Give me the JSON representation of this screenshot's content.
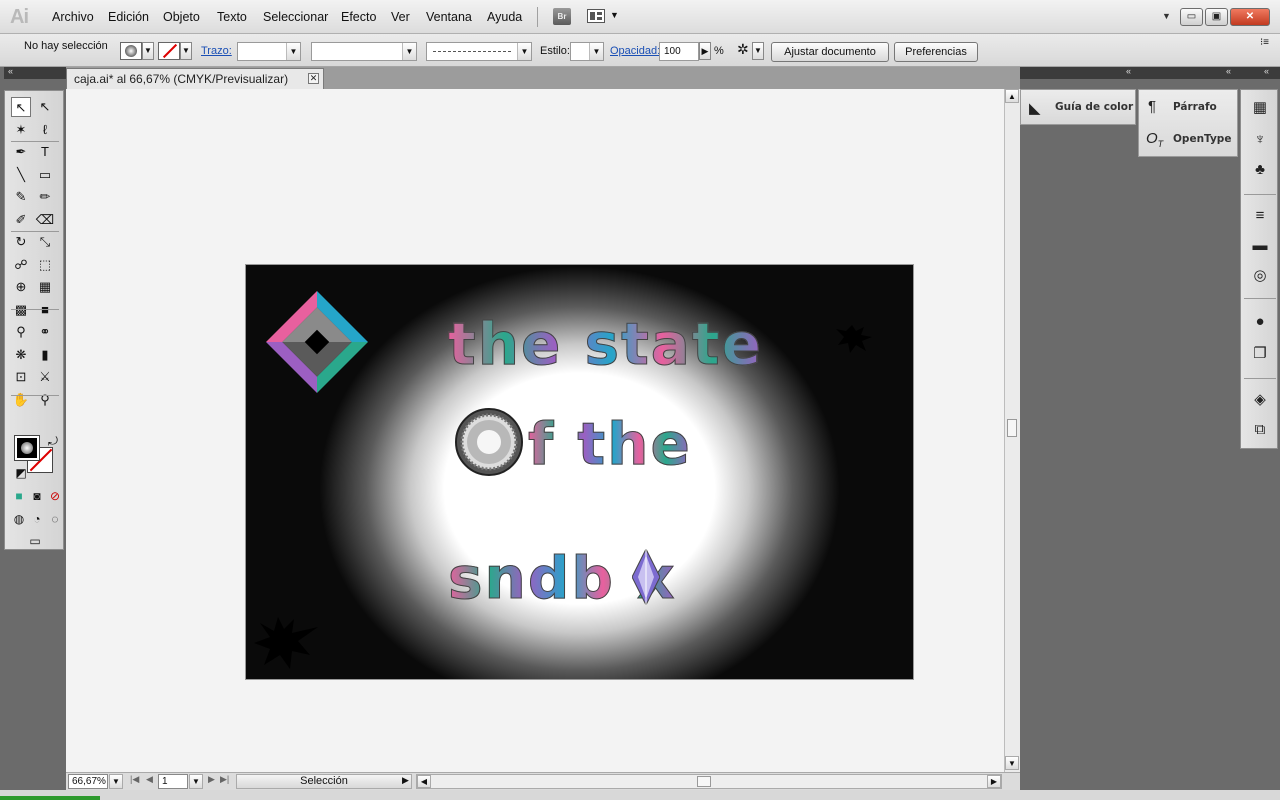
{
  "app": {
    "logo": "Ai"
  },
  "menu": [
    "Archivo",
    "Edición",
    "Objeto",
    "Texto",
    "Seleccionar",
    "Efecto",
    "Ver",
    "Ventana",
    "Ayuda"
  ],
  "menu_extra": {
    "bridge": "Br"
  },
  "window_controls": {
    "minimize": "▭",
    "restore": "▣",
    "close": "✕"
  },
  "control_bar": {
    "selection_status": "No hay selección",
    "stroke_label": "Trazo:",
    "style_label": "Estilo:",
    "opacity_label": "Opacidad:",
    "opacity_value": "100",
    "opacity_unit": "%",
    "fit_document_button": "Ajustar documento",
    "preferences_button": "Preferencias"
  },
  "document": {
    "tab_title": "caja.ai* al 66,67% (CMYK/Previsualizar)",
    "tab_close": "✕"
  },
  "artwork": {
    "line1": "the state",
    "line2": "f the",
    "line3": "sndb x",
    "colors": {
      "pink": "#e8609e",
      "teal": "#2aa88c",
      "purple": "#9c5fc2",
      "cyan": "#25a5c9"
    }
  },
  "status_bar": {
    "zoom": "66,67%",
    "page": "1",
    "status_text": "Selección"
  },
  "panels": {
    "color_guide": "Guía de color",
    "paragraph": "Párrafo",
    "opentype": "OpenType"
  },
  "collapse_glyph": "«",
  "tools": [
    {
      "name": "selection-tool-icon",
      "glyph": "↖"
    },
    {
      "name": "direct-selection-tool-icon",
      "glyph": "↖"
    },
    {
      "name": "magic-wand-tool-icon",
      "glyph": "✶"
    },
    {
      "name": "lasso-tool-icon",
      "glyph": "ℓ"
    },
    {
      "name": "pen-tool-icon",
      "glyph": "✒"
    },
    {
      "name": "type-tool-icon",
      "glyph": "T"
    },
    {
      "name": "line-tool-icon",
      "glyph": "╲"
    },
    {
      "name": "rectangle-tool-icon",
      "glyph": "▭"
    },
    {
      "name": "paintbrush-tool-icon",
      "glyph": "✎"
    },
    {
      "name": "pencil-tool-icon",
      "glyph": "✏"
    },
    {
      "name": "blob-brush-tool-icon",
      "glyph": "✐"
    },
    {
      "name": "eraser-tool-icon",
      "glyph": "⌫"
    },
    {
      "name": "rotate-tool-icon",
      "glyph": "↻"
    },
    {
      "name": "scale-tool-icon",
      "glyph": "⤡"
    },
    {
      "name": "warp-tool-icon",
      "glyph": "☍"
    },
    {
      "name": "free-transform-tool-icon",
      "glyph": "⬚"
    },
    {
      "name": "shape-builder-tool-icon",
      "glyph": "⊕"
    },
    {
      "name": "perspective-grid-tool-icon",
      "glyph": "▦"
    },
    {
      "name": "mesh-tool-icon",
      "glyph": "▩"
    },
    {
      "name": "gradient-tool-icon",
      "glyph": "■"
    },
    {
      "name": "eyedropper-tool-icon",
      "glyph": "⚲"
    },
    {
      "name": "blend-tool-icon",
      "glyph": "⚭"
    },
    {
      "name": "symbol-sprayer-tool-icon",
      "glyph": "❋"
    },
    {
      "name": "column-graph-tool-icon",
      "glyph": "▮"
    },
    {
      "name": "artboard-tool-icon",
      "glyph": "⊡"
    },
    {
      "name": "slice-tool-icon",
      "glyph": "⚔"
    },
    {
      "name": "hand-tool-icon",
      "glyph": "✋"
    },
    {
      "name": "zoom-tool-icon",
      "glyph": "⚲"
    }
  ],
  "right_strip_icons": [
    {
      "name": "swatches-panel-icon",
      "glyph": "▦"
    },
    {
      "name": "brushes-panel-icon",
      "glyph": "♆"
    },
    {
      "name": "symbols-panel-icon",
      "glyph": "♣"
    },
    {
      "name": "stroke-panel-icon",
      "glyph": "≡"
    },
    {
      "name": "gradient-panel-icon",
      "glyph": "▬"
    },
    {
      "name": "transparency-panel-icon",
      "glyph": "◎"
    },
    {
      "name": "appearance-panel-icon",
      "glyph": "●"
    },
    {
      "name": "graphic-styles-panel-icon",
      "glyph": "❐"
    },
    {
      "name": "layers-panel-icon",
      "glyph": "◈"
    },
    {
      "name": "artboards-panel-icon",
      "glyph": "⧉"
    }
  ]
}
